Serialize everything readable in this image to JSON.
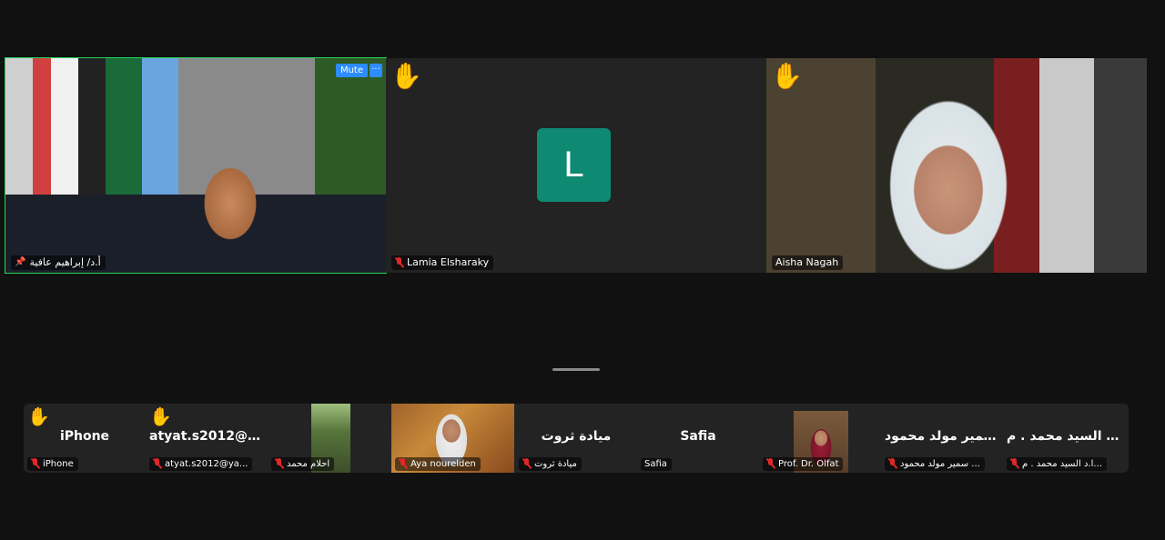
{
  "main_tiles": [
    {
      "name": "أ.د/ إبراهيم عافية",
      "pinned": true,
      "active_speaker": true
    },
    {
      "name": "Lamia Elsharaky",
      "avatar_letter": "L",
      "hand_raised": true,
      "muted": true
    },
    {
      "name": "Aisha Nagah",
      "hand_raised": true
    }
  ],
  "controls": {
    "mute_label": "Mute",
    "more_label": "···"
  },
  "strip": [
    {
      "display": "iPhone",
      "name": "iPhone",
      "hand_raised": true
    },
    {
      "display": "atyat.s2012@ya...",
      "name": "atyat.s2012@ya...",
      "hand_raised": true
    },
    {
      "display": "",
      "name": "احلام محمد"
    },
    {
      "display": "",
      "name": "Aya nourelden"
    },
    {
      "display": "ميادة ثروت",
      "name": "ميادة ثروت"
    },
    {
      "display": "Safia",
      "name": "Safia"
    },
    {
      "display": "",
      "name": "Prof. Dr. Olfat"
    },
    {
      "display": "سمير مولد محمود...",
      "name": "سمير مولد محمود ..."
    },
    {
      "display": "ا.د السيد محمد . م...",
      "name": "ا.د السيد محمد . م..."
    }
  ],
  "colors": {
    "active_border": "#23d959",
    "accent": "#2d8cff",
    "avatar_bg": "#0e8a73",
    "muted_mic": "#e02828"
  }
}
